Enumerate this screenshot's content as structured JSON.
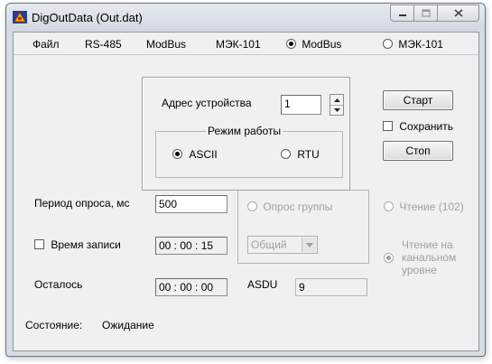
{
  "window": {
    "title": "DigOutData (Out.dat)"
  },
  "menubar": {
    "items": [
      "Файл",
      "RS-485",
      "ModBus",
      "МЭК-101"
    ],
    "radio_modbus": "ModBus",
    "radio_mek": "МЭК-101"
  },
  "panel": {
    "address_label": "Адрес устройства",
    "address_value": "1",
    "mode_group_label": "Режим работы",
    "mode_ascii": "ASCII",
    "mode_rtu": "RTU"
  },
  "buttons": {
    "start": "Старт",
    "save_label": "Сохранить",
    "stop": "Стоп"
  },
  "form": {
    "poll_period_label": "Период опроса, мс",
    "poll_period_value": "500",
    "record_time_label": "Время записи",
    "record_time_value": "00 : 00 : 15",
    "remaining_label": "Осталось",
    "remaining_value": "00 : 00 : 00",
    "asdu_label": "ASDU",
    "asdu_value": "9",
    "group_poll_label": "Опрос группы",
    "group_combo_value": "Общий",
    "read_102_label": "Чтение (102)",
    "read_channel_label": "Чтение на канальном уровне"
  },
  "status": {
    "label": "Состояние:",
    "value": "Ожидание"
  },
  "icons": {
    "app": "app-icon",
    "minimize": "minimize-icon",
    "maximize": "maximize-icon",
    "close": "close-icon"
  }
}
